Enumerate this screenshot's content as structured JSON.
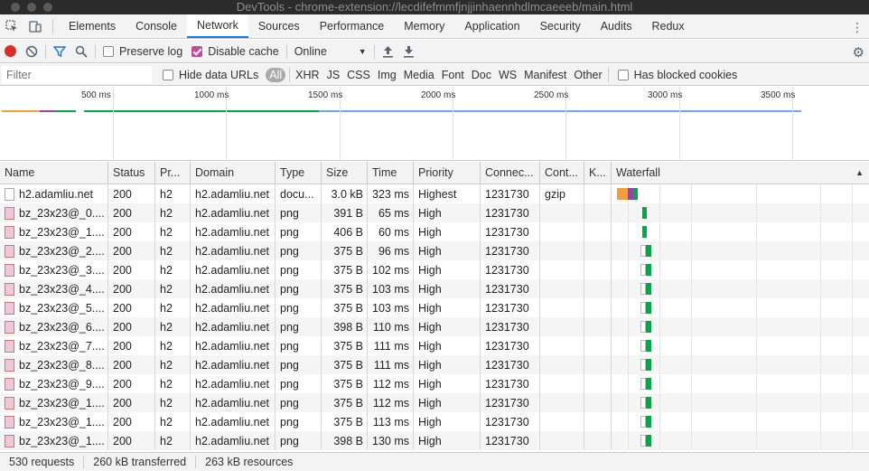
{
  "window": {
    "title": "DevTools - chrome-extension://lecdifefmmfjnjjinhaennhdlmcaeeeb/main.html"
  },
  "tabs": [
    "Elements",
    "Console",
    "Network",
    "Sources",
    "Performance",
    "Memory",
    "Application",
    "Security",
    "Audits",
    "Redux"
  ],
  "active_tab": "Network",
  "toolbar": {
    "preserve_log": "Preserve log",
    "disable_cache": "Disable cache",
    "throttling": "Online"
  },
  "filter": {
    "placeholder": "Filter",
    "hide_data_urls": "Hide data URLs",
    "types": [
      "All",
      "XHR",
      "JS",
      "CSS",
      "Img",
      "Media",
      "Font",
      "Doc",
      "WS",
      "Manifest",
      "Other"
    ],
    "blocked_cookies": "Has blocked cookies"
  },
  "overview": {
    "ticks": [
      "500 ms",
      "1000 ms",
      "1500 ms",
      "2000 ms",
      "2500 ms",
      "3000 ms",
      "3500 ms"
    ]
  },
  "columns": [
    "Name",
    "Status",
    "Pr...",
    "Domain",
    "Type",
    "Size",
    "Time",
    "Priority",
    "Connec...",
    "Cont...",
    "K...",
    "Waterfall"
  ],
  "rows": [
    {
      "name": "h2.adamliu.net",
      "status": "200",
      "protocol": "h2",
      "domain": "h2.adamliu.net",
      "type": "docu...",
      "size": "3.0 kB",
      "time": "323 ms",
      "priority": "Highest",
      "connection": "1231730",
      "content": "gzip",
      "kind": "doc"
    },
    {
      "name": "bz_23x23@_0....",
      "status": "200",
      "protocol": "h2",
      "domain": "h2.adamliu.net",
      "type": "png",
      "size": "391 B",
      "time": "65 ms",
      "priority": "High",
      "connection": "1231730",
      "content": "",
      "kind": "img"
    },
    {
      "name": "bz_23x23@_1....",
      "status": "200",
      "protocol": "h2",
      "domain": "h2.adamliu.net",
      "type": "png",
      "size": "406 B",
      "time": "60 ms",
      "priority": "High",
      "connection": "1231730",
      "content": "",
      "kind": "img"
    },
    {
      "name": "bz_23x23@_2....",
      "status": "200",
      "protocol": "h2",
      "domain": "h2.adamliu.net",
      "type": "png",
      "size": "375 B",
      "time": "96 ms",
      "priority": "High",
      "connection": "1231730",
      "content": "",
      "kind": "img"
    },
    {
      "name": "bz_23x23@_3....",
      "status": "200",
      "protocol": "h2",
      "domain": "h2.adamliu.net",
      "type": "png",
      "size": "375 B",
      "time": "102 ms",
      "priority": "High",
      "connection": "1231730",
      "content": "",
      "kind": "img"
    },
    {
      "name": "bz_23x23@_4....",
      "status": "200",
      "protocol": "h2",
      "domain": "h2.adamliu.net",
      "type": "png",
      "size": "375 B",
      "time": "103 ms",
      "priority": "High",
      "connection": "1231730",
      "content": "",
      "kind": "img"
    },
    {
      "name": "bz_23x23@_5....",
      "status": "200",
      "protocol": "h2",
      "domain": "h2.adamliu.net",
      "type": "png",
      "size": "375 B",
      "time": "103 ms",
      "priority": "High",
      "connection": "1231730",
      "content": "",
      "kind": "img"
    },
    {
      "name": "bz_23x23@_6....",
      "status": "200",
      "protocol": "h2",
      "domain": "h2.adamliu.net",
      "type": "png",
      "size": "398 B",
      "time": "110 ms",
      "priority": "High",
      "connection": "1231730",
      "content": "",
      "kind": "img"
    },
    {
      "name": "bz_23x23@_7....",
      "status": "200",
      "protocol": "h2",
      "domain": "h2.adamliu.net",
      "type": "png",
      "size": "375 B",
      "time": "111 ms",
      "priority": "High",
      "connection": "1231730",
      "content": "",
      "kind": "img"
    },
    {
      "name": "bz_23x23@_8....",
      "status": "200",
      "protocol": "h2",
      "domain": "h2.adamliu.net",
      "type": "png",
      "size": "375 B",
      "time": "111 ms",
      "priority": "High",
      "connection": "1231730",
      "content": "",
      "kind": "img"
    },
    {
      "name": "bz_23x23@_9....",
      "status": "200",
      "protocol": "h2",
      "domain": "h2.adamliu.net",
      "type": "png",
      "size": "375 B",
      "time": "112 ms",
      "priority": "High",
      "connection": "1231730",
      "content": "",
      "kind": "img"
    },
    {
      "name": "bz_23x23@_1....",
      "status": "200",
      "protocol": "h2",
      "domain": "h2.adamliu.net",
      "type": "png",
      "size": "375 B",
      "time": "112 ms",
      "priority": "High",
      "connection": "1231730",
      "content": "",
      "kind": "img"
    },
    {
      "name": "bz_23x23@_1....",
      "status": "200",
      "protocol": "h2",
      "domain": "h2.adamliu.net",
      "type": "png",
      "size": "375 B",
      "time": "113 ms",
      "priority": "High",
      "connection": "1231730",
      "content": "",
      "kind": "img"
    },
    {
      "name": "bz_23x23@_1....",
      "status": "200",
      "protocol": "h2",
      "domain": "h2.adamliu.net",
      "type": "png",
      "size": "398 B",
      "time": "130 ms",
      "priority": "High",
      "connection": "1231730",
      "content": "",
      "kind": "img"
    }
  ],
  "statusbar": {
    "requests": "530 requests",
    "transferred": "260 kB transferred",
    "resources": "263 kB resources"
  },
  "colors": {
    "accent": "#1a73e8",
    "record": "#d93025",
    "waiting": "#00a846",
    "queue": "#f29e3d",
    "ssl": "#9b3fae"
  }
}
